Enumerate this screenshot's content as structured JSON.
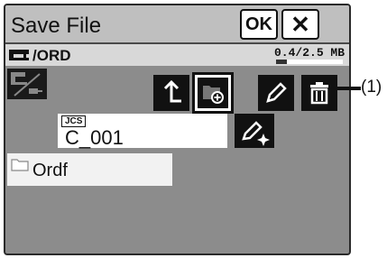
{
  "title": "Save File",
  "buttons": {
    "ok": "OK",
    "close": "✕"
  },
  "path": "/ORD",
  "capacity": {
    "used": "0.4",
    "separator": "/",
    "total": "2.5 MB",
    "fraction": 0.16
  },
  "file": {
    "format_tag": "JCS",
    "name": "C_001"
  },
  "folders": [
    {
      "name": "Ordf"
    }
  ],
  "callout": "(1)",
  "icons": [
    "sewing-machine-icon",
    "usb-device-icon",
    "up-arrow-icon",
    "new-folder-icon",
    "pencil-icon",
    "trash-icon",
    "edit-name-icon",
    "folder-icon"
  ]
}
